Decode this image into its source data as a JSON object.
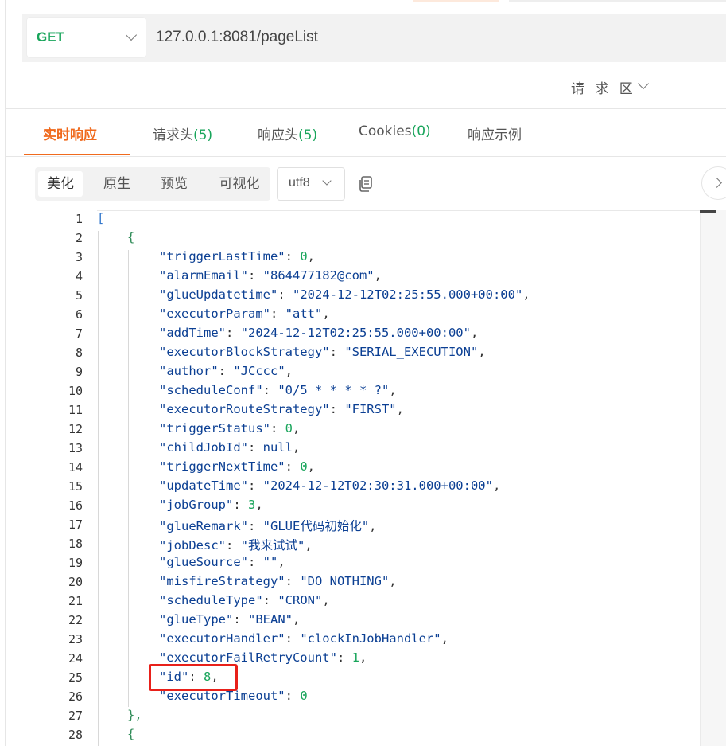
{
  "request": {
    "method": "GET",
    "url": "127.0.0.1:8081/pageList",
    "request_area_label": "请 求 区"
  },
  "response_tabs": [
    {
      "label": "实时响应",
      "count": ""
    },
    {
      "label": "请求头",
      "count": "(5)"
    },
    {
      "label": "响应头",
      "count": "(5)"
    },
    {
      "label": "Cookies",
      "count": "(0)"
    },
    {
      "label": "响应示例",
      "count": ""
    }
  ],
  "view_modes": [
    "美化",
    "原生",
    "预览",
    "可视化"
  ],
  "encoding": "utf8",
  "icons": {
    "method_dropdown": "chevron-down-icon",
    "encoding_dropdown": "chevron-down-icon",
    "request_area_toggle": "chevron-down-icon",
    "copy": "copy-icon",
    "side_panel": "chevron-right-icon"
  },
  "colors": {
    "accent": "#f06a1d",
    "method_get": "#19a55b",
    "highlight": "#e8201a"
  },
  "code_lines": [
    {
      "no": "1",
      "text": "["
    },
    {
      "no": "2",
      "text": "{"
    },
    {
      "no": "3",
      "key": "\"triggerLastTime\"",
      "val": "0",
      "type": "num",
      "comma": ","
    },
    {
      "no": "4",
      "key": "\"alarmEmail\"",
      "val": "\"864477182@com\"",
      "type": "str",
      "comma": ","
    },
    {
      "no": "5",
      "key": "\"glueUpdatetime\"",
      "val": "\"2024-12-12T02:25:55.000+00:00\"",
      "type": "str",
      "comma": ","
    },
    {
      "no": "6",
      "key": "\"executorParam\"",
      "val": "\"att\"",
      "type": "str",
      "comma": ","
    },
    {
      "no": "7",
      "key": "\"addTime\"",
      "val": "\"2024-12-12T02:25:55.000+00:00\"",
      "type": "str",
      "comma": ","
    },
    {
      "no": "8",
      "key": "\"executorBlockStrategy\"",
      "val": "\"SERIAL_EXECUTION\"",
      "type": "str",
      "comma": ","
    },
    {
      "no": "9",
      "key": "\"author\"",
      "val": "\"JCccc\"",
      "type": "str",
      "comma": ","
    },
    {
      "no": "10",
      "key": "\"scheduleConf\"",
      "val": "\"0/5 * * * * ?\"",
      "type": "str",
      "comma": ","
    },
    {
      "no": "11",
      "key": "\"executorRouteStrategy\"",
      "val": "\"FIRST\"",
      "type": "str",
      "comma": ","
    },
    {
      "no": "12",
      "key": "\"triggerStatus\"",
      "val": "0",
      "type": "num",
      "comma": ","
    },
    {
      "no": "13",
      "key": "\"childJobId\"",
      "val": "null",
      "type": "str",
      "comma": ","
    },
    {
      "no": "14",
      "key": "\"triggerNextTime\"",
      "val": "0",
      "type": "num",
      "comma": ","
    },
    {
      "no": "15",
      "key": "\"updateTime\"",
      "val": "\"2024-12-12T02:30:31.000+00:00\"",
      "type": "str",
      "comma": ","
    },
    {
      "no": "16",
      "key": "\"jobGroup\"",
      "val": "3",
      "type": "num",
      "comma": ","
    },
    {
      "no": "17",
      "key": "\"glueRemark\"",
      "val": "\"GLUE代码初始化\"",
      "type": "str",
      "comma": ","
    },
    {
      "no": "18",
      "key": "\"jobDesc\"",
      "val": "\"我来试试\"",
      "type": "str",
      "comma": ","
    },
    {
      "no": "19",
      "key": "\"glueSource\"",
      "val": "\"\"",
      "type": "str",
      "comma": ","
    },
    {
      "no": "20",
      "key": "\"misfireStrategy\"",
      "val": "\"DO_NOTHING\"",
      "type": "str",
      "comma": ","
    },
    {
      "no": "21",
      "key": "\"scheduleType\"",
      "val": "\"CRON\"",
      "type": "str",
      "comma": ","
    },
    {
      "no": "22",
      "key": "\"glueType\"",
      "val": "\"BEAN\"",
      "type": "str",
      "comma": ","
    },
    {
      "no": "23",
      "key": "\"executorHandler\"",
      "val": "\"clockInJobHandler\"",
      "type": "str",
      "comma": ","
    },
    {
      "no": "24",
      "key": "\"executorFailRetryCount\"",
      "val": "1",
      "type": "num",
      "comma": ","
    },
    {
      "no": "25",
      "key": "\"id\"",
      "val": "8",
      "type": "num",
      "comma": ","
    },
    {
      "no": "26",
      "key": "\"executorTimeout\"",
      "val": "0",
      "type": "num",
      "comma": ""
    },
    {
      "no": "27",
      "text": "},"
    },
    {
      "no": "28",
      "text": "{"
    }
  ]
}
